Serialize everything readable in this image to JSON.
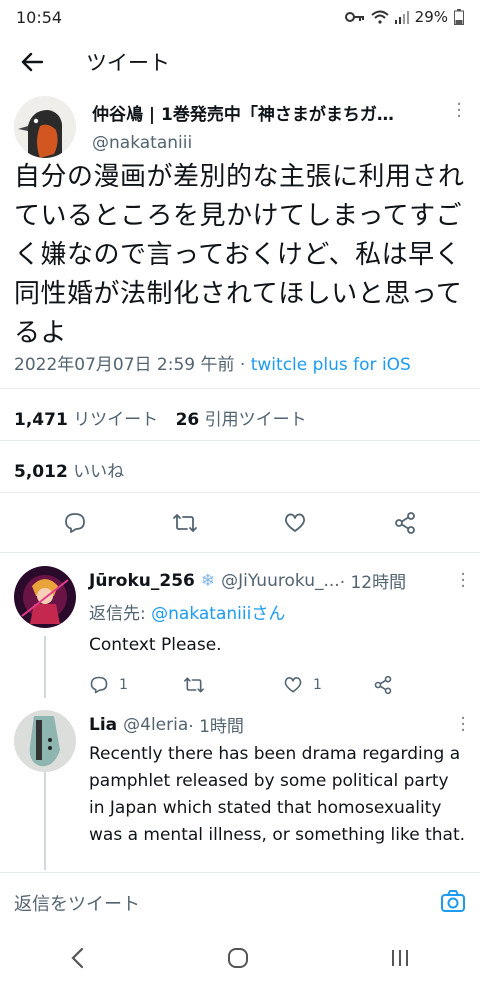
{
  "status_bar": {
    "time": "10:54",
    "battery": "29%"
  },
  "header": {
    "title": "ツイート"
  },
  "tweet": {
    "author_name": "仲谷鳰 | 1巻発売中「神さまがまちガ…",
    "author_handle": "@nakataniii",
    "text": "自分の漫画が差別的な主張に利用されているところを見かけてしまってすごく嫌なので言っておくけど、私は早く同性婚が法制化されてほしいと思ってるよ",
    "timestamp": "2022年07月07日 2:59 午前 · ",
    "client": "twitcle plus for iOS",
    "retweets_count": "1,471",
    "retweets_label": "リツイート",
    "quotes_count": "26",
    "quotes_label": "引用ツイート",
    "likes_count": "5,012",
    "likes_label": "いいね"
  },
  "replies": [
    {
      "name": "Jūroku_256",
      "handle": "@JiYuuroku_...",
      "time": " · 12時間",
      "reply_to_prefix": "返信先: ",
      "reply_to_handle": "@nakataniiiさん",
      "text": "Context Please.",
      "reply_count": "1",
      "like_count": "1"
    },
    {
      "name": "Lia",
      "handle": "@4leria",
      "time": " · 1時間",
      "text": "Recently there has been drama regarding a pamphlet released by some political party in Japan which stated that homosexuality was a mental illness, or something like that."
    }
  ],
  "compose": {
    "placeholder": "返信をツイート"
  },
  "colors": {
    "accent": "#1d9bf0",
    "text": "#0f1419",
    "muted": "#536471"
  }
}
